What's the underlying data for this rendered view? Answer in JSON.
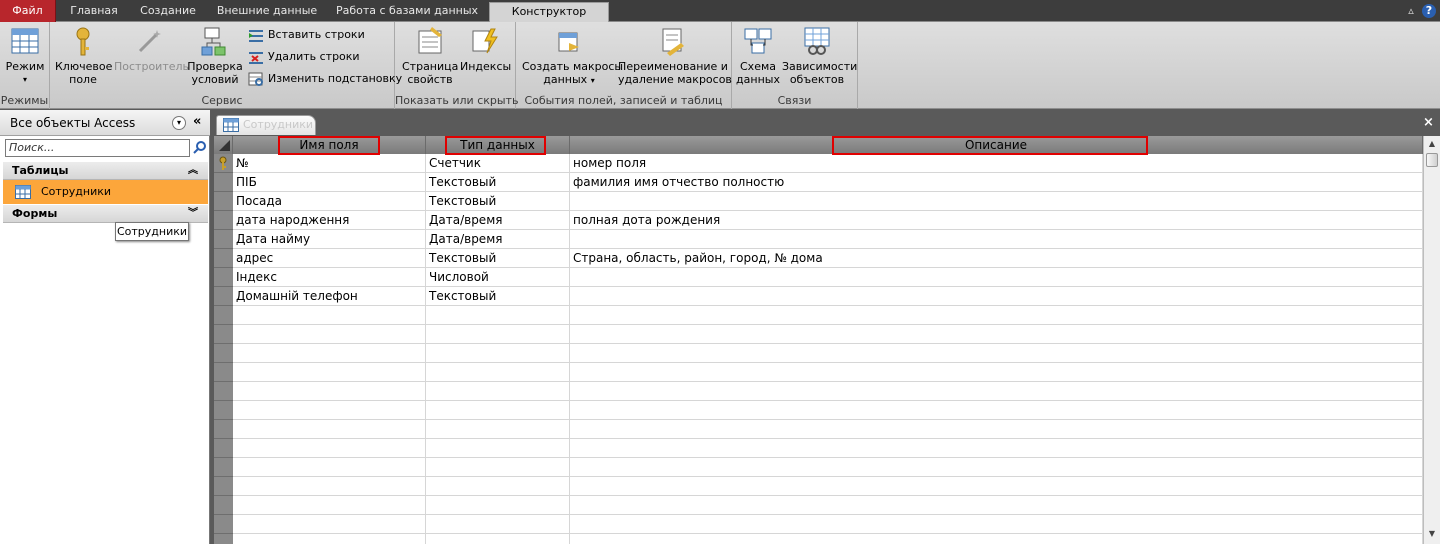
{
  "ribbon_tabs": {
    "file": "Файл",
    "home": "Главная",
    "create": "Создание",
    "external": "Внешние данные",
    "database": "Работа с базами данных",
    "design": "Конструктор"
  },
  "ribbon": {
    "views": {
      "view": "Режим",
      "group": "Режимы"
    },
    "tools": {
      "primary_key_1": "Ключевое",
      "primary_key_2": "поле",
      "builder": "Построитель",
      "test_1": "Проверка",
      "test_2": "условий",
      "insert_rows": "Вставить строки",
      "delete_rows": "Удалить строки",
      "modify_lookups": "Изменить подстановку",
      "group": "Сервис"
    },
    "showhide": {
      "property_1": "Страница",
      "property_2": "свойств",
      "indexes": "Индексы",
      "group": "Показать или скрыть"
    },
    "events": {
      "create_1": "Создать макросы",
      "create_2": "данных",
      "rename_1": "Переименование и",
      "rename_2": "удаление макросов",
      "group": "События полей, записей и таблиц"
    },
    "relations": {
      "schema_1": "Схема",
      "schema_2": "данных",
      "deps_1": "Зависимости",
      "deps_2": "объектов",
      "group": "Связи"
    }
  },
  "nav": {
    "title": "Все объекты Access",
    "search_placeholder": "Поиск...",
    "group_tables": "Таблицы",
    "table_item": "Сотрудники",
    "group_forms": "Формы",
    "tooltip": "Сотрудники"
  },
  "doc_tab": "Сотрудники",
  "grid": {
    "headers": [
      "Имя поля",
      "Тип данных",
      "Описание"
    ],
    "rows": [
      {
        "name": "№",
        "type": "Счетчик",
        "desc": "номер поля",
        "key": true
      },
      {
        "name": "ПІБ",
        "type": "Текстовый",
        "desc": "фамилия имя отчество полностю"
      },
      {
        "name": "Посада",
        "type": "Текстовый",
        "desc": ""
      },
      {
        "name": "дата народження",
        "type": "Дата/время",
        "desc": "полная дота рождения"
      },
      {
        "name": "Дата найму",
        "type": "Дата/время",
        "desc": ""
      },
      {
        "name": "адрес",
        "type": "Текстовый",
        "desc": "Страна, область, район, город, № дома"
      },
      {
        "name": "Індекс",
        "type": "Числовой",
        "desc": ""
      },
      {
        "name": "Домашній телефон",
        "type": "Текстовый",
        "desc": ""
      }
    ],
    "total_rows": 21
  },
  "colors": {
    "file_tab": "#b8262c",
    "nav_selected": "#fca63b",
    "highlight_box": "#e00000"
  }
}
